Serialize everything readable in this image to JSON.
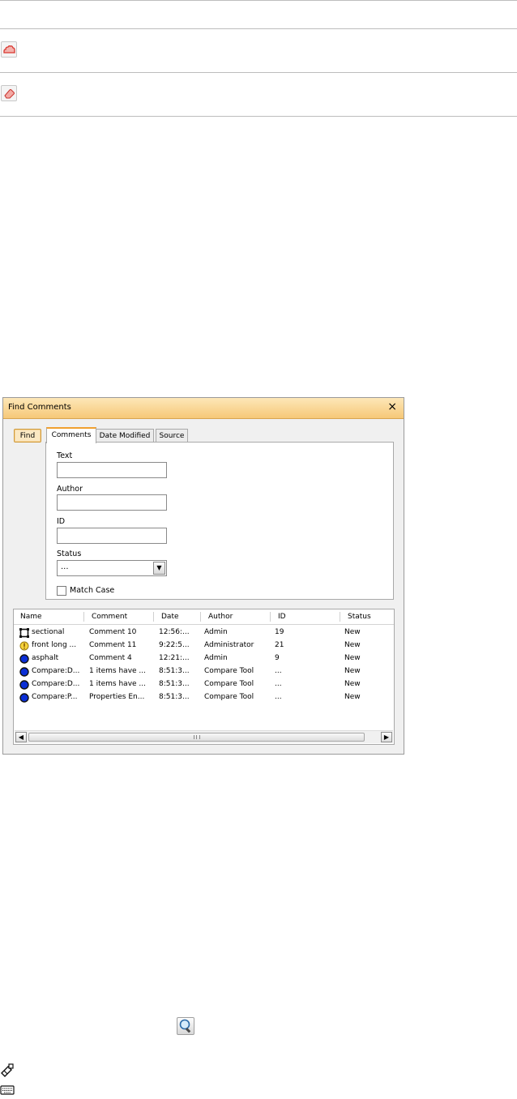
{
  "dialog": {
    "title": "Find Comments",
    "close_glyph": "×",
    "find_button": "Find",
    "tabs": [
      {
        "label": "Comments",
        "active": true
      },
      {
        "label": "Date Modified",
        "active": false
      },
      {
        "label": "Source",
        "active": false
      }
    ],
    "fields": {
      "text_label": "Text",
      "text_value": "",
      "author_label": "Author",
      "author_value": "",
      "id_label": "ID",
      "id_value": "",
      "status_label": "Status",
      "status_value": "...",
      "match_case_label": "Match Case",
      "match_case_checked": false
    },
    "list": {
      "columns": [
        "Name",
        "Comment",
        "Date",
        "Author",
        "ID",
        "Status"
      ],
      "rows": [
        {
          "icon": "rectangle-markup-icon",
          "name": "sectional",
          "comment": "Comment 10",
          "date": "12:56:...",
          "author": "Admin",
          "id": "19",
          "status": "New"
        },
        {
          "icon": "warning-tag-icon",
          "name": "front long ...",
          "comment": "Comment 11",
          "date": "9:22:5...",
          "author": "Administrator",
          "id": "21",
          "status": "New"
        },
        {
          "icon": "blue-circle-icon",
          "name": "asphalt",
          "comment": "Comment 4",
          "date": "12:21:...",
          "author": "Admin",
          "id": "9",
          "status": "New"
        },
        {
          "icon": "blue-circle-icon",
          "name": "Compare:D...",
          "comment": "1 items have ...",
          "date": "8:51:3...",
          "author": "Compare Tool",
          "id": "...",
          "status": "New"
        },
        {
          "icon": "blue-circle-icon",
          "name": "Compare:D...",
          "comment": "1 items have ...",
          "date": "8:51:3...",
          "author": "Compare Tool",
          "id": "...",
          "status": "New"
        },
        {
          "icon": "blue-circle-icon",
          "name": "Compare:P...",
          "comment": "Properties En...",
          "date": "8:51:3...",
          "author": "Compare Tool",
          "id": "...",
          "status": "New"
        }
      ]
    }
  },
  "colors": {
    "titlebar_accent": "#f6c878",
    "markup_red": "#d9362f",
    "status_blue": "#0b2fd6"
  },
  "icons": {
    "row1": "cloud-markup-icon",
    "row2": "eraser-icon",
    "bottom_button": "zoom-search-icon",
    "bottom_left_1": "selection-tools-icon",
    "bottom_left_2": "keyboard-icon"
  }
}
